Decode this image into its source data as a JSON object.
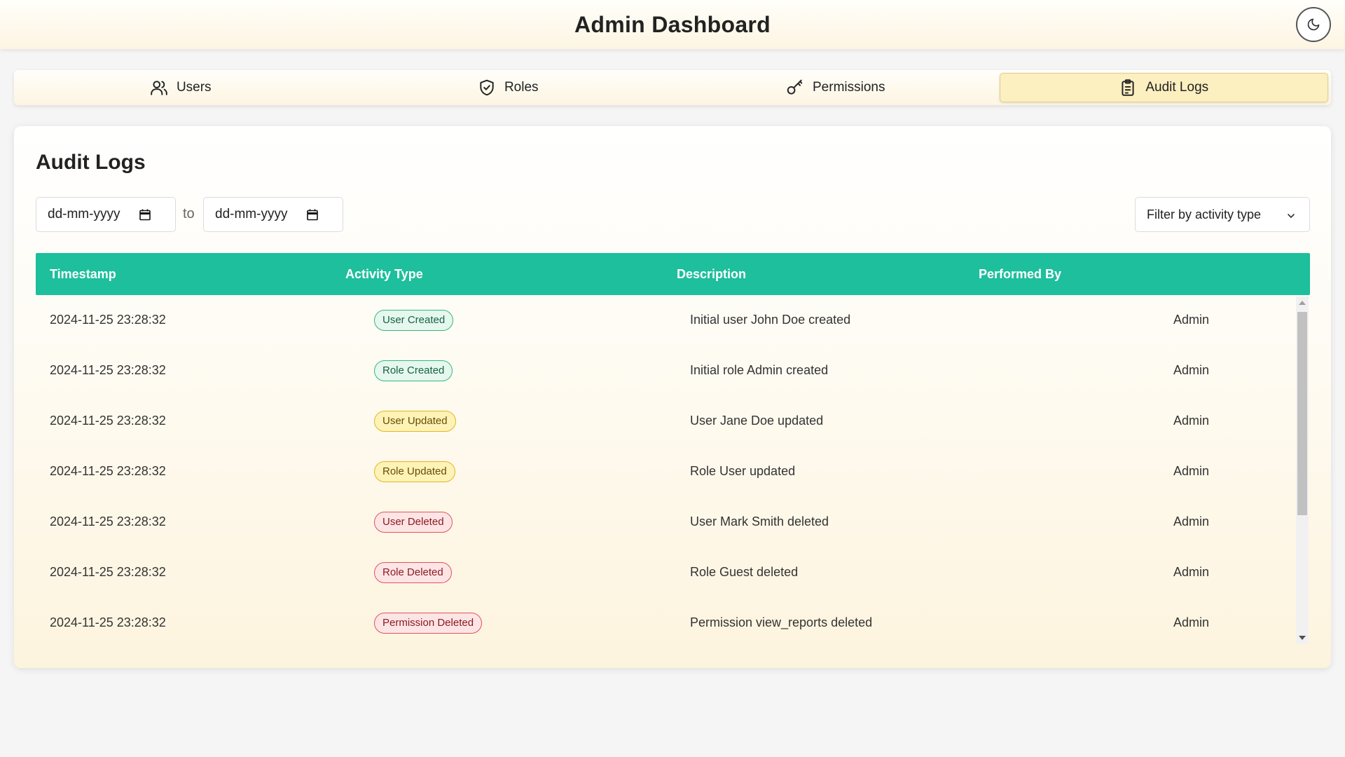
{
  "header": {
    "title": "Admin Dashboard",
    "theme_toggle_icon": "moon-icon"
  },
  "tabs": [
    {
      "label": "Users",
      "icon": "users-icon",
      "active": false
    },
    {
      "label": "Roles",
      "icon": "shield-icon",
      "active": false
    },
    {
      "label": "Permissions",
      "icon": "key-icon",
      "active": false
    },
    {
      "label": "Audit Logs",
      "icon": "clipboard-icon",
      "active": true
    }
  ],
  "audit": {
    "title": "Audit Logs",
    "date_from_placeholder": "dd-mm-yyyy",
    "date_separator": "to",
    "date_to_placeholder": "dd-mm-yyyy",
    "filter_placeholder": "Filter by activity type",
    "columns": [
      "Timestamp",
      "Activity Type",
      "Description",
      "Performed By"
    ],
    "rows": [
      {
        "timestamp": "2024-11-25 23:28:32",
        "activity": "User Created",
        "kind": "created",
        "description": "Initial user John Doe created",
        "performed_by": "Admin"
      },
      {
        "timestamp": "2024-11-25 23:28:32",
        "activity": "Role Created",
        "kind": "created",
        "description": "Initial role Admin created",
        "performed_by": "Admin"
      },
      {
        "timestamp": "2024-11-25 23:28:32",
        "activity": "User Updated",
        "kind": "updated",
        "description": "User Jane Doe updated",
        "performed_by": "Admin"
      },
      {
        "timestamp": "2024-11-25 23:28:32",
        "activity": "Role Updated",
        "kind": "updated",
        "description": "Role User updated",
        "performed_by": "Admin"
      },
      {
        "timestamp": "2024-11-25 23:28:32",
        "activity": "User Deleted",
        "kind": "deleted",
        "description": "User Mark Smith deleted",
        "performed_by": "Admin"
      },
      {
        "timestamp": "2024-11-25 23:28:32",
        "activity": "Role Deleted",
        "kind": "deleted",
        "description": "Role Guest deleted",
        "performed_by": "Admin"
      },
      {
        "timestamp": "2024-11-25 23:28:32",
        "activity": "Permission Deleted",
        "kind": "deleted",
        "description": "Permission view_reports deleted",
        "performed_by": "Admin"
      }
    ]
  },
  "colors": {
    "accent": "#1dbf9c",
    "created": "#34b87b",
    "updated": "#e2b626",
    "deleted": "#e2525a"
  }
}
